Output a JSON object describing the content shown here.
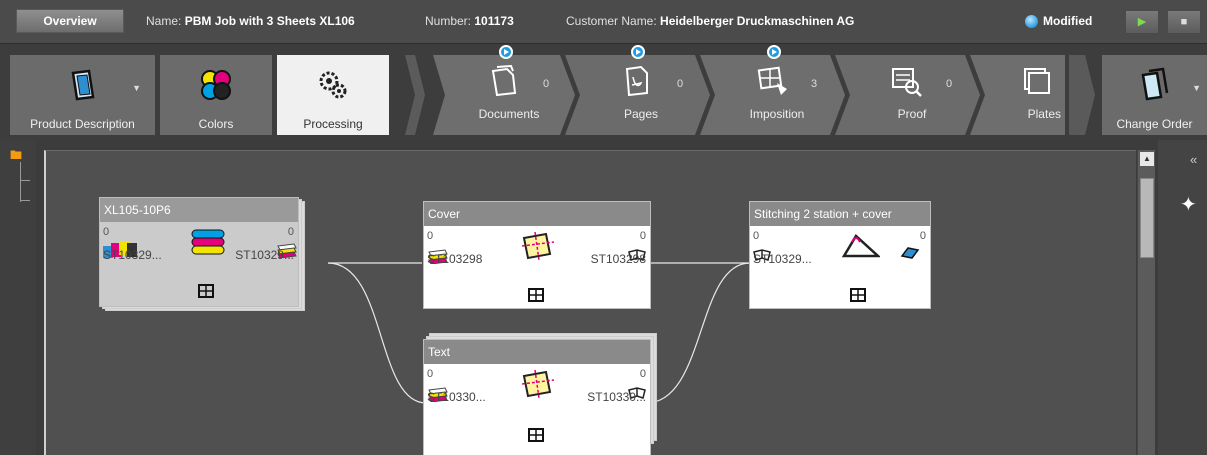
{
  "header": {
    "overview_label": "Overview",
    "name_label": "Name:",
    "name_value": "PBM Job with 3 Sheets XL106",
    "number_label": "Number:",
    "number_value": "101173",
    "customer_label": "Customer Name:",
    "customer_value": "Heidelberger Druckmaschinen AG",
    "status": "Modified",
    "status_color": "#3fa7e6"
  },
  "toolbar": {
    "tools": [
      {
        "label": "Product Description",
        "icon": "product-description-icon"
      },
      {
        "label": "Colors",
        "icon": "colors-icon"
      },
      {
        "label": "Processing",
        "icon": "processing-gears-icon"
      }
    ],
    "steps": [
      {
        "label": "Documents",
        "count": "0"
      },
      {
        "label": "Pages",
        "count": "0"
      },
      {
        "label": "Imposition",
        "count": "3"
      },
      {
        "label": "Proof",
        "count": "0"
      },
      {
        "label": "Plates"
      }
    ],
    "change_order_label": "Change Order"
  },
  "canvas": {
    "nodes": [
      {
        "title": "XL105-10P6",
        "left_count": "0",
        "right_count": "0",
        "left_id": "ST10329...",
        "right_id": "ST10329..."
      },
      {
        "title": "Cover",
        "left_count": "0",
        "right_count": "0",
        "left_id": "ST103298",
        "right_id": "ST103298"
      },
      {
        "title": "Stitching 2 station + cover",
        "left_count": "0",
        "right_count": "0",
        "left_id": "ST10329..."
      },
      {
        "title": "Text",
        "left_count": "0",
        "right_count": "0",
        "left_id": "ST10330...",
        "right_id": "ST10330..."
      }
    ]
  },
  "accent_play": "#1f9be0"
}
